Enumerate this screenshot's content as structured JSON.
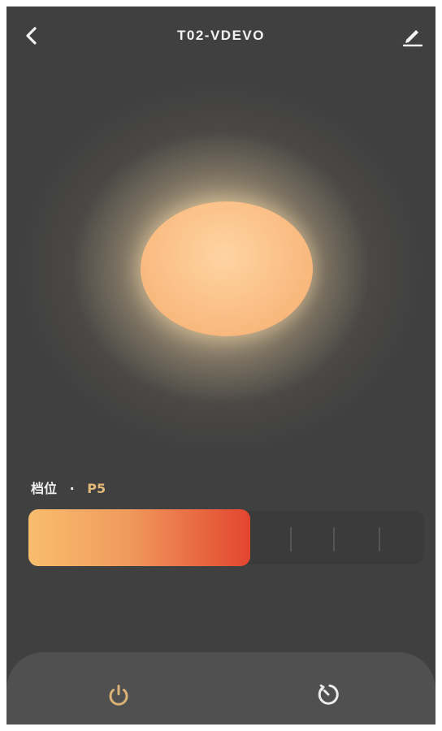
{
  "header": {
    "title": "T02-VDEVO",
    "back_icon": "chevron-left-icon",
    "edit_icon": "pencil-icon"
  },
  "lamp": {
    "state": "on",
    "color": "#fbc28a",
    "glow_color": "#ffe9c0"
  },
  "level": {
    "label": "档位",
    "separator": "·",
    "value": "P5",
    "fill_fraction": 0.56,
    "fill_colors": [
      "#f9bd6e",
      "#e3452f"
    ],
    "ticks": 3
  },
  "bottom_bar": {
    "power_icon": "power-icon",
    "power_color": "#dcb277",
    "timer_icon": "timer-icon",
    "timer_color": "#ececec"
  },
  "colors": {
    "background": "#404040",
    "accent": "#e3b979",
    "text": "#f2f2f2"
  }
}
